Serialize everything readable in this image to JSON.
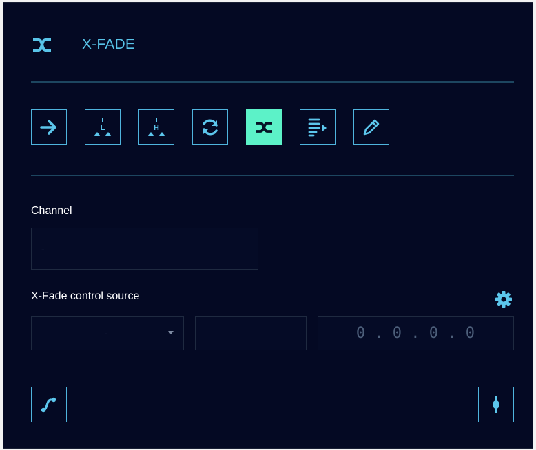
{
  "header": {
    "title": "X-FADE",
    "icon": "crossfade-icon"
  },
  "toolbar": {
    "buttons": [
      {
        "icon": "arrow-right-icon",
        "glyph": ""
      },
      {
        "icon": "low-mark-icon",
        "glyph": "L"
      },
      {
        "icon": "high-mark-icon",
        "glyph": "H"
      },
      {
        "icon": "refresh-icon",
        "glyph": ""
      },
      {
        "icon": "crossfade-icon",
        "glyph": "",
        "active": true
      },
      {
        "icon": "list-play-icon",
        "glyph": ""
      },
      {
        "icon": "pencil-icon",
        "glyph": ""
      }
    ]
  },
  "channel": {
    "label": "Channel",
    "value": "-"
  },
  "xfade_source": {
    "label": "X-Fade control source",
    "select_value": "-",
    "middle_value": "",
    "address_value": "0 . 0 . 0 . 0"
  },
  "colors": {
    "accent": "#5cc6ec",
    "active": "#5cf2c8",
    "background": "#040923"
  }
}
